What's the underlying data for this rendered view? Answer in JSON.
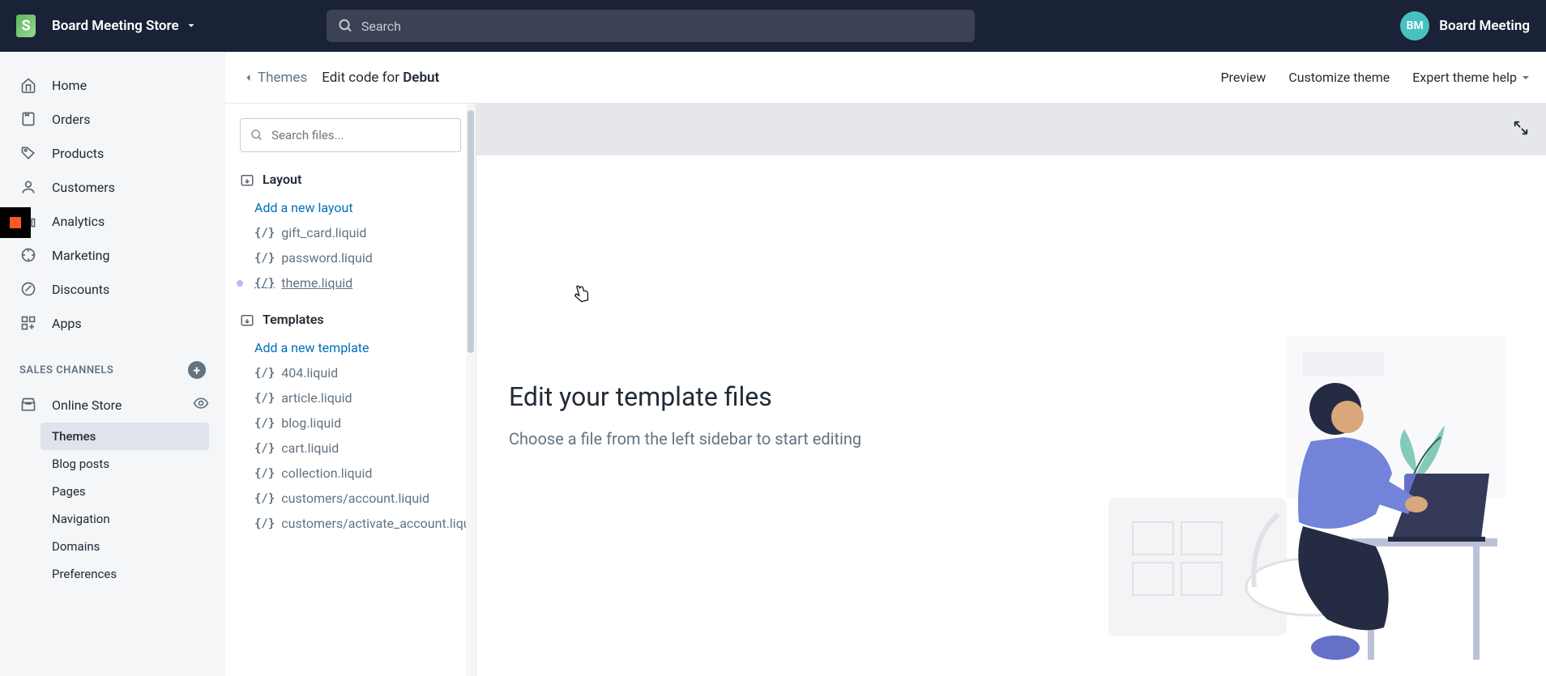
{
  "topbar": {
    "store_name": "Board Meeting Store",
    "search_placeholder": "Search",
    "user_initials": "BM",
    "user_name": "Board Meeting"
  },
  "sidebar": {
    "nav": [
      {
        "label": "Home"
      },
      {
        "label": "Orders"
      },
      {
        "label": "Products"
      },
      {
        "label": "Customers"
      },
      {
        "label": "Analytics"
      },
      {
        "label": "Marketing"
      },
      {
        "label": "Discounts"
      },
      {
        "label": "Apps"
      }
    ],
    "section_title": "SALES CHANNELS",
    "online_store": "Online Store",
    "subnav": [
      {
        "label": "Themes"
      },
      {
        "label": "Blog posts"
      },
      {
        "label": "Pages"
      },
      {
        "label": "Navigation"
      },
      {
        "label": "Domains"
      },
      {
        "label": "Preferences"
      }
    ]
  },
  "header": {
    "back": "Themes",
    "title_prefix": "Edit code for ",
    "title_bold": "Debut",
    "preview": "Preview",
    "customize": "Customize theme",
    "expert": "Expert theme help"
  },
  "files": {
    "search_placeholder": "Search files...",
    "layout_label": "Layout",
    "add_layout": "Add a new layout",
    "layout_files": [
      {
        "name": "gift_card.liquid"
      },
      {
        "name": "password.liquid"
      },
      {
        "name": "theme.liquid",
        "modified": true,
        "hovered": true
      }
    ],
    "templates_label": "Templates",
    "add_template": "Add a new template",
    "template_files": [
      {
        "name": "404.liquid"
      },
      {
        "name": "article.liquid"
      },
      {
        "name": "blog.liquid"
      },
      {
        "name": "cart.liquid"
      },
      {
        "name": "collection.liquid"
      },
      {
        "name": "customers/account.liquid"
      },
      {
        "name": "customers/activate_account.liquid"
      }
    ]
  },
  "editor": {
    "heading": "Edit your template files",
    "subtext": "Choose a file from the left sidebar to start editing"
  }
}
